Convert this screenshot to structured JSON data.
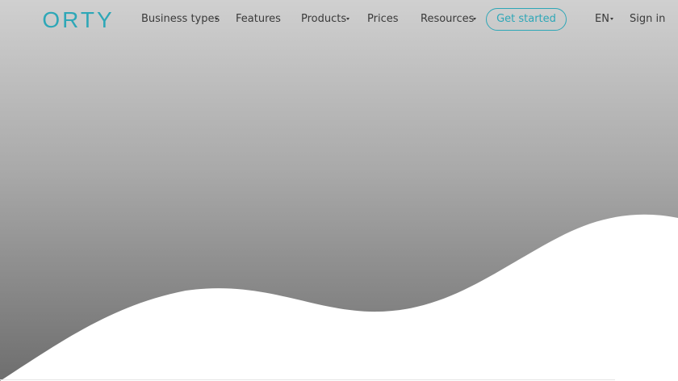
{
  "header": {
    "logo_text": "ORTY",
    "nav": [
      {
        "label": "Business types",
        "has_dropdown": true
      },
      {
        "label": "Features",
        "has_dropdown": false
      },
      {
        "label": "Products",
        "has_dropdown": true
      },
      {
        "label": "Prices",
        "has_dropdown": false
      },
      {
        "label": "Resources",
        "has_dropdown": true
      }
    ],
    "cta_label": "Get started",
    "language": "EN",
    "sign_in_label": "Sign in"
  },
  "colors": {
    "brand": "#2ea7b7",
    "nav_text": "#3a3a3a",
    "hero_gradient_top": "#d0d0d0",
    "hero_gradient_bottom": "#6e6e6e",
    "wave_fill": "#ffffff"
  },
  "icons": {
    "dropdown": "chevron-down-icon",
    "language_dropdown": "chevron-down-icon"
  }
}
